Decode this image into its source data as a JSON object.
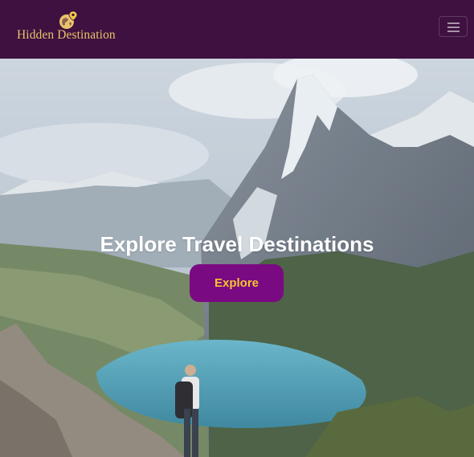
{
  "brand": {
    "name": "Hidden Destination",
    "icon": "globe-pin-icon",
    "color": "#e9c46a"
  },
  "navbar": {
    "background": "#3f1140",
    "toggler_icon": "hamburger-menu-icon"
  },
  "hero": {
    "title": "Explore Travel Destinations",
    "button_label": "Explore",
    "button_color": "#7a0a82",
    "button_text_color": "#f4c430"
  }
}
